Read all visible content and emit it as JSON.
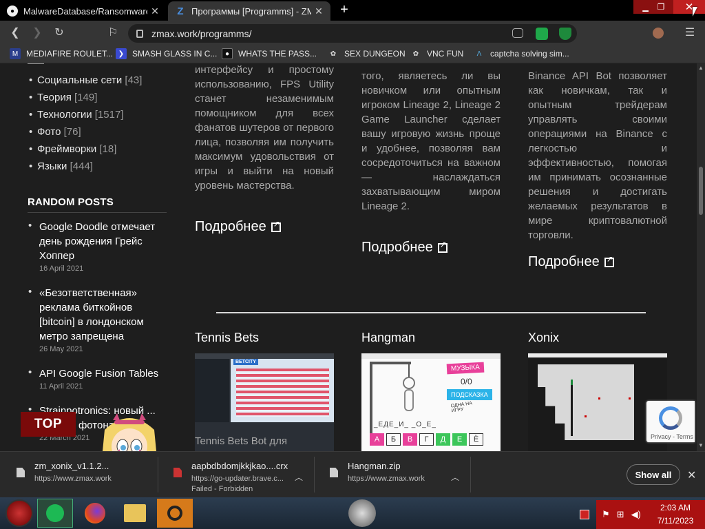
{
  "browser": {
    "tabs": [
      {
        "title": "MalwareDatabase/Ransomware/Tr",
        "icon": "github-icon"
      },
      {
        "title": "Программы [Programms] - ZMax",
        "icon": "zmax-icon"
      }
    ],
    "new_tab": "+",
    "url": "zmax.work/programms/",
    "bookmarks": [
      {
        "label": "MEDIAFIRE ROULET...",
        "icon": "mediafire-icon"
      },
      {
        "label": "SMASH GLASS IN C...",
        "icon": "bookmark-icon"
      },
      {
        "label": "WHATS THE PASS...",
        "icon": "bookmark-icon"
      },
      {
        "label": "SEX DUNGEON",
        "icon": "bookmark-icon"
      },
      {
        "label": "VNC FUN",
        "icon": "bookmark-icon"
      },
      {
        "label": "captcha solving sim...",
        "icon": "bookmark-icon"
      }
    ]
  },
  "sidebar": {
    "categories": [
      {
        "name": "Социальные сети",
        "count": "[43]"
      },
      {
        "name": "Теория",
        "count": "[149]"
      },
      {
        "name": "Технологии",
        "count": "[1517]"
      },
      {
        "name": "Фото",
        "count": "[76]"
      },
      {
        "name": "Фреймворки",
        "count": "[18]"
      },
      {
        "name": "Языки",
        "count": "[444]"
      }
    ],
    "random_posts_heading": "RANDOM POSTS",
    "posts": [
      {
        "title": "Google Doodle отмечает день рождения Грейс Хоппер",
        "date": "16 April 2021"
      },
      {
        "title": "«Безответственная» реклама биткойнов [bitcoin] в лондонском метро запрещена",
        "date": "26 May 2021"
      },
      {
        "title": "API Google Fusion Tables",
        "date": "11 April 2021"
      },
      {
        "title": "Strainpotronics: новый ... управ... фотонами",
        "date": "22 March 2021"
      }
    ]
  },
  "main": {
    "columns": [
      {
        "text": "интерфейсу и простому использованию, FPS Utility станет незаменимым помощником для всех фанатов шутеров от первого лица, позволяя им получить максимум удовольствия от игры и выйти на новый уровень мастерства.",
        "more": "Подробнее"
      },
      {
        "text": "того, являетесь ли вы новичком или опытным игроком Lineage 2, Lineage 2 Game Launcher сделает вашу игровую жизнь проще и удобнее, позволяя вам сосредоточиться на важном — наслаждаться захватывающим миром Lineage 2.",
        "more": "Подробнее"
      },
      {
        "text": "Binance API Bot позволяет как новичкам, так и опытным трейдерам управлять своими операциями на Binance с легкостью и эффективностью, помогая им принимать осознанные решения и достигать желаемых результатов в мире криптовалютной торговли.",
        "more": "Подробнее"
      }
    ],
    "products": [
      {
        "title": "Tennis Bets",
        "snippet": "Tennis Bets Bot для"
      },
      {
        "title": "Hangman",
        "snippet": ""
      },
      {
        "title": "Xonix",
        "snippet": ""
      }
    ],
    "hangman_thumb": {
      "music": "МУЗЫКА",
      "score": "0/0",
      "hint": "ПОДСКАЗКА",
      "one_game": "ОДНА НА ИГРУ",
      "word": "_ЕДЕ_И_ _О_Е_",
      "letters": [
        "А",
        "Б",
        "В",
        "Г",
        "Д",
        "Е",
        "Ё"
      ]
    },
    "tennis_thumb": {
      "brand": "BETCITY"
    },
    "top_button": "TOP",
    "recaptcha": {
      "links": "Privacy - Terms"
    }
  },
  "downloads": [
    {
      "name": "zm_xonix_v1.1.2...",
      "status": "https://www.zmax.work"
    },
    {
      "name": "aapbdbdomjkkjkao....crx",
      "status": "https://go-updater.brave.c...",
      "error": "Failed - Forbidden"
    },
    {
      "name": "Hangman.zip",
      "status": "https://www.zmax.work"
    }
  ],
  "download_bar": {
    "show_all": "Show all"
  },
  "taskbar": {
    "time": "2:03 AM",
    "date": "7/11/2023"
  }
}
